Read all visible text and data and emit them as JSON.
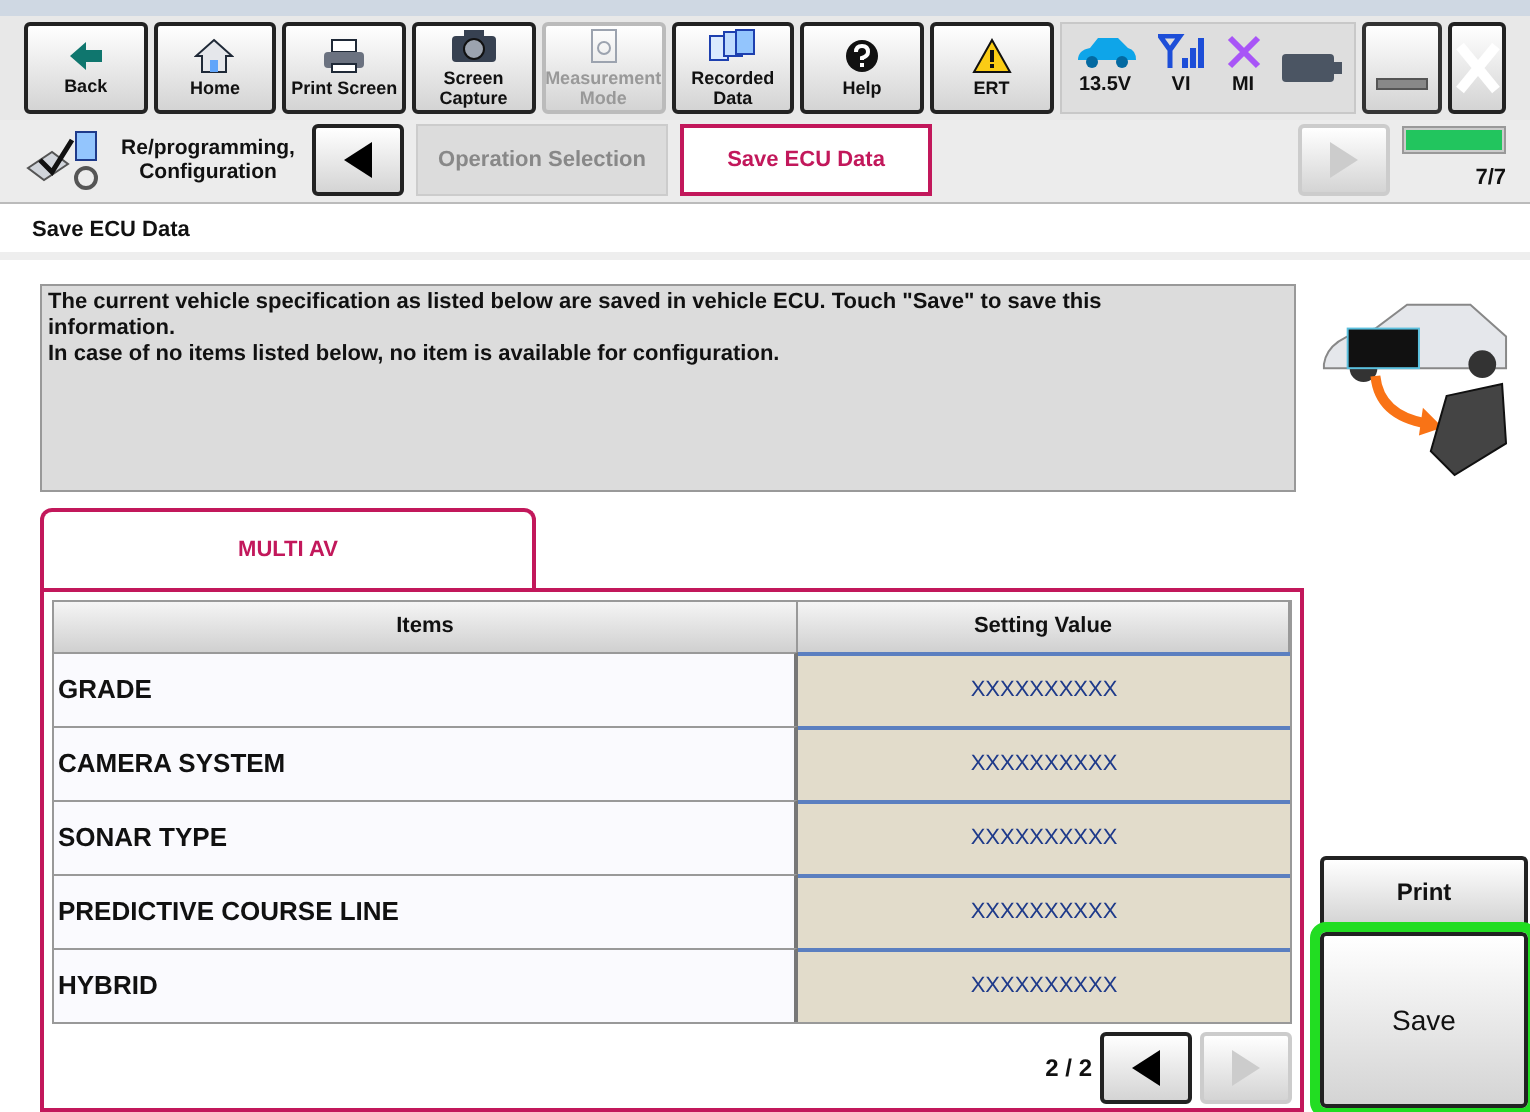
{
  "toolbar": [
    {
      "label": "Back",
      "kind": "back",
      "disabled": false
    },
    {
      "label": "Home",
      "kind": "home",
      "disabled": false
    },
    {
      "label": "Print Screen",
      "kind": "print",
      "disabled": false
    },
    {
      "label": "Screen Capture",
      "kind": "camera",
      "disabled": false
    },
    {
      "label": "Measurement Mode",
      "kind": "meter",
      "disabled": true
    },
    {
      "label": "Recorded Data",
      "kind": "files",
      "disabled": false
    },
    {
      "label": "Help",
      "kind": "help",
      "disabled": false
    },
    {
      "label": "ERT",
      "kind": "warning",
      "disabled": false
    }
  ],
  "status": [
    {
      "label": "13.5V",
      "kind": "car"
    },
    {
      "label": "VI",
      "kind": "signal"
    },
    {
      "label": "MI",
      "kind": "cross"
    },
    {
      "kind": "battery"
    }
  ],
  "breadcrumb": {
    "section": "Re/programming, Configuration",
    "steps": [
      {
        "label": "Operation Selection",
        "selected": false
      },
      {
        "label": "Save ECU Data",
        "selected": true
      }
    ],
    "back_disabled": false,
    "forward_disabled": true,
    "progress": {
      "level": 1,
      "reading": "7/7"
    }
  },
  "page_title": "Save ECU Data",
  "info": [
    "The current vehicle specification as listed below are saved in vehicle ECU. Touch \"Save\" to save this information.",
    "In case of no items listed below, no item is available for configuration."
  ],
  "tabs": [
    {
      "label": "MULTI AV",
      "selected": true
    }
  ],
  "table": {
    "columns": [
      "Items",
      "Setting Value"
    ],
    "rows": [
      [
        "GRADE",
        "XXXXXXXXXX"
      ],
      [
        "CAMERA SYSTEM",
        "XXXXXXXXXX"
      ],
      [
        "SONAR TYPE",
        "XXXXXXXXXX"
      ],
      [
        "PREDICTIVE COURSE LINE",
        "XXXXXXXXXX"
      ],
      [
        "HYBRID",
        "XXXXXXXXXX"
      ]
    ]
  },
  "pager": {
    "reading": "2 / 2",
    "prev_disabled": false,
    "next_disabled": true
  },
  "buttons": [
    {
      "label": "Print",
      "highlighted": false
    },
    {
      "label": "Save",
      "highlighted": true
    }
  ]
}
